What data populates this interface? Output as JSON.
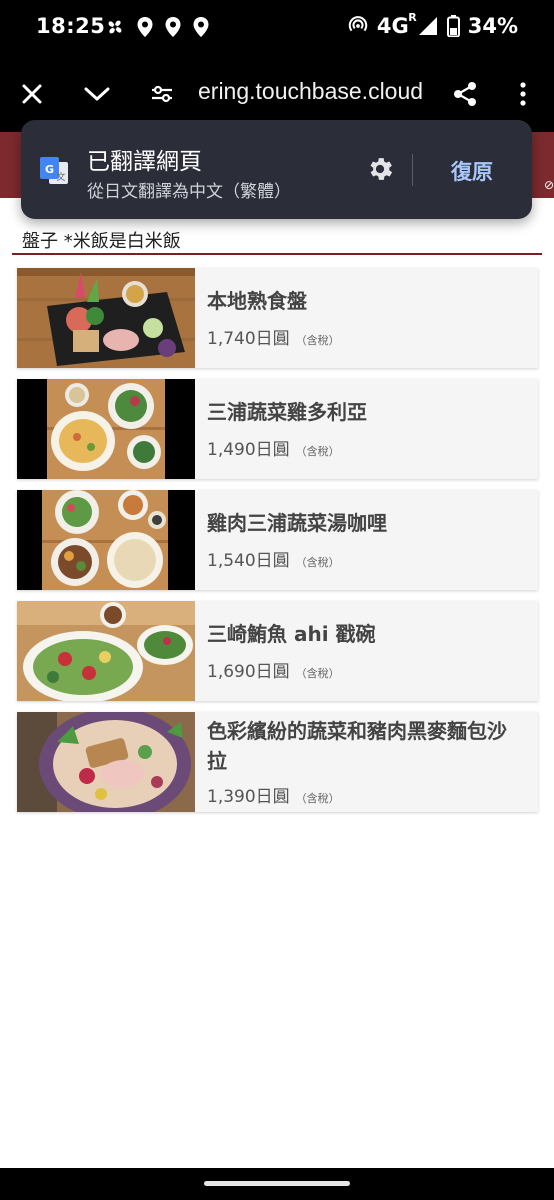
{
  "status_bar": {
    "time": "18:25",
    "network": "4G",
    "roaming": "R",
    "battery": "34%"
  },
  "browser": {
    "url": "ering.touchbase.cloud"
  },
  "translate_popup": {
    "title": "已翻譯網頁",
    "subtitle": "從日文翻譯為中文（繁體）",
    "restore_label": "復原"
  },
  "section": {
    "heading": "盤子 *米飯是白米飯"
  },
  "menu": {
    "tax_label": "（含稅）",
    "items": [
      {
        "name": "本地熟食盤",
        "price": "1,740日圓"
      },
      {
        "name": "三浦蔬菜雞多利亞",
        "price": "1,490日圓"
      },
      {
        "name": "雞肉三浦蔬菜湯咖哩",
        "price": "1,540日圓"
      },
      {
        "name": "三崎鮪魚 ahi 戳碗",
        "price": "1,690日圓"
      },
      {
        "name": "色彩繽紛的蔬菜和豬肉黑麥麵包沙拉",
        "price": "1,390日圓"
      }
    ]
  },
  "colors": {
    "header_band": "#7c2a2e",
    "accent_rule": "#7a1f25",
    "popup_bg": "#2b2d38",
    "restore_text": "#a8c7fa"
  }
}
